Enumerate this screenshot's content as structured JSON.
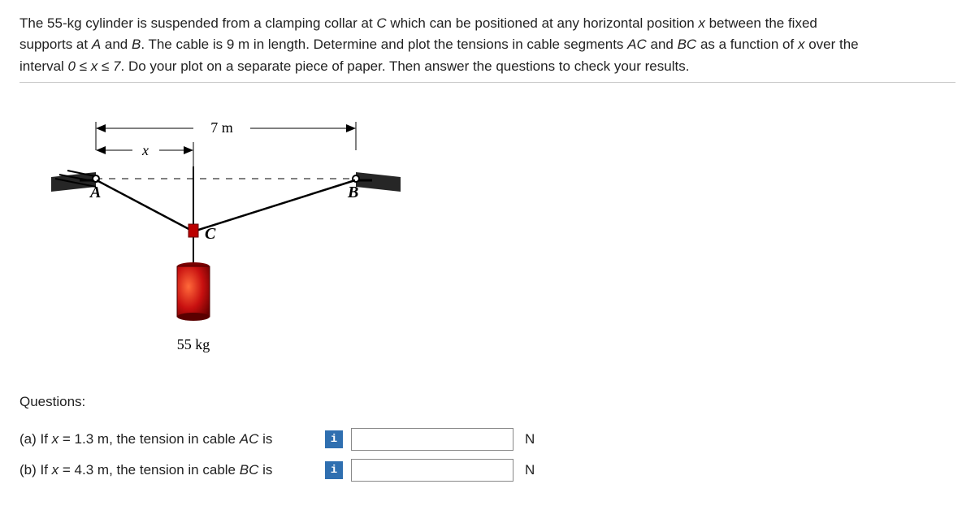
{
  "problem": {
    "line1_a": "The ",
    "mass": "55",
    "line1_b": "-kg cylinder is suspended from a clamping collar at ",
    "pointC": "C",
    "line1_c": " which can be positioned at any horizontal position ",
    "var_x": "x",
    "line1_d": " between the fixed",
    "line2_a": "supports at ",
    "pointA": "A",
    "line2_b": " and ",
    "pointB": "B",
    "line2_c": ". The cable is ",
    "cable_len": "9",
    "line2_d": " m in length. Determine and plot the tensions in cable segments ",
    "segAC": "AC",
    "line2_e": " and ",
    "segBC": "BC",
    "line2_f": " as a function of ",
    "var_x2": "x",
    "line2_g": " over the",
    "line3_a": "interval ",
    "interval": "0 ≤ x ≤ 7",
    "line3_b": ". Do your plot on a separate piece of paper. Then answer the questions to check your results."
  },
  "diagram": {
    "span": "7 m",
    "var": "x",
    "A": "A",
    "B": "B",
    "C": "C",
    "mass_label": "55 kg"
  },
  "questions": {
    "heading": "Questions:",
    "a_prefix": "(a) If ",
    "a_xvar": "x",
    "a_val": " = 1.3 m, the tension in cable ",
    "a_seg": "AC",
    "a_suffix": " is",
    "b_prefix": "(b) If ",
    "b_xvar": "x",
    "b_val": " = 4.3 m, the tension in cable ",
    "b_seg": "BC",
    "b_suffix": " is",
    "unit": "N",
    "info_glyph": "i"
  }
}
